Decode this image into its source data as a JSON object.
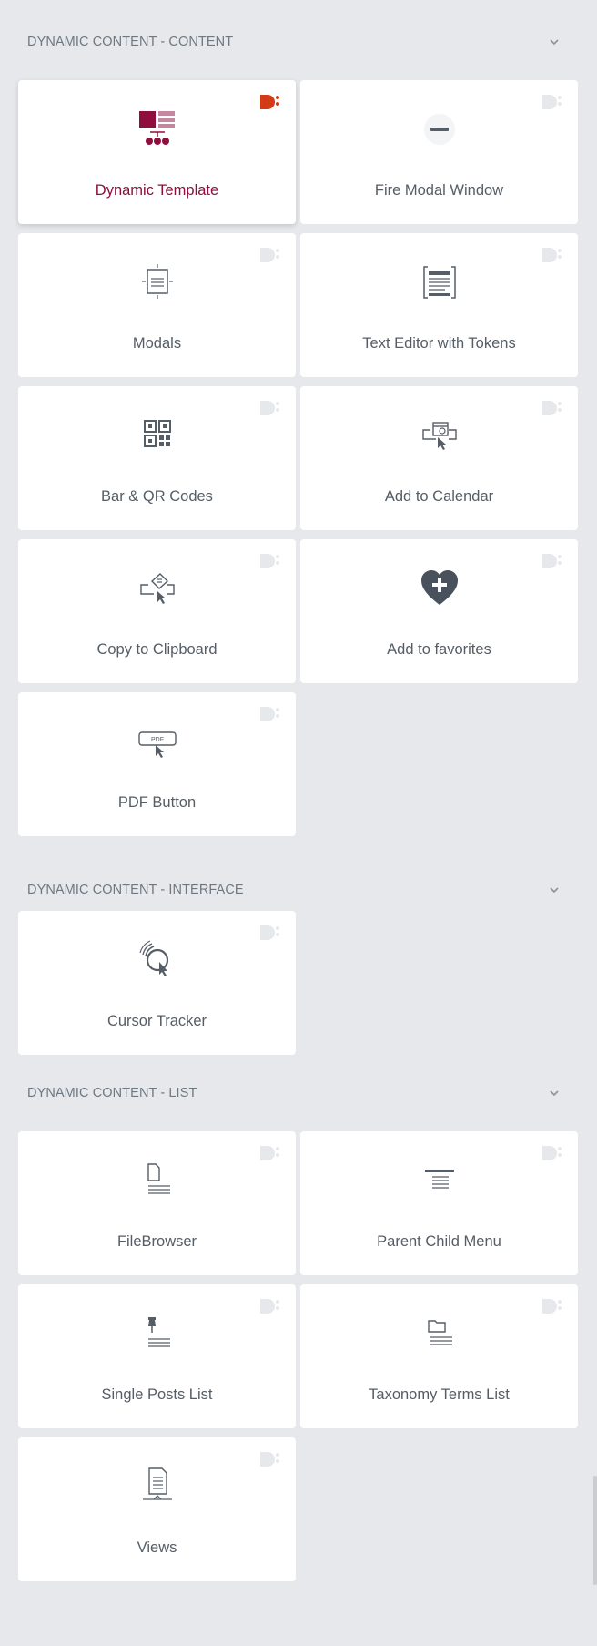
{
  "sections": [
    {
      "title": "DYNAMIC CONTENT - CONTENT",
      "widgets": [
        {
          "label": "Dynamic Template",
          "icon": "dynamic-template-icon"
        },
        {
          "label": "Fire Modal Window",
          "icon": "fire-modal-icon"
        },
        {
          "label": "Modals",
          "icon": "modals-icon"
        },
        {
          "label": "Text Editor with Tokens",
          "icon": "text-editor-tokens-icon"
        },
        {
          "label": "Bar & QR Codes",
          "icon": "qr-code-icon"
        },
        {
          "label": "Add to Calendar",
          "icon": "calendar-click-icon"
        },
        {
          "label": "Copy to Clipboard",
          "icon": "clipboard-click-icon"
        },
        {
          "label": "Add to favorites",
          "icon": "heart-plus-icon"
        },
        {
          "label": "PDF Button",
          "icon": "pdf-button-icon"
        }
      ]
    },
    {
      "title": "DYNAMIC CONTENT - INTERFACE",
      "widgets": [
        {
          "label": "Cursor Tracker",
          "icon": "cursor-tracker-icon"
        }
      ]
    },
    {
      "title": "DYNAMIC CONTENT - LIST",
      "widgets": [
        {
          "label": "FileBrowser",
          "icon": "file-browser-icon"
        },
        {
          "label": "Parent Child Menu",
          "icon": "parent-child-menu-icon"
        },
        {
          "label": "Single Posts List",
          "icon": "pin-list-icon"
        },
        {
          "label": "Taxonomy Terms List",
          "icon": "folder-list-icon"
        },
        {
          "label": "Views",
          "icon": "views-document-icon"
        }
      ]
    }
  ],
  "colors": {
    "panel_bg": "#e6e8eb",
    "card_bg": "#ffffff",
    "active_label": "#8e0e3e",
    "badge_active": "#d23b16",
    "badge_inactive": "#e6e8eb",
    "icon_stroke": "#555d66"
  }
}
